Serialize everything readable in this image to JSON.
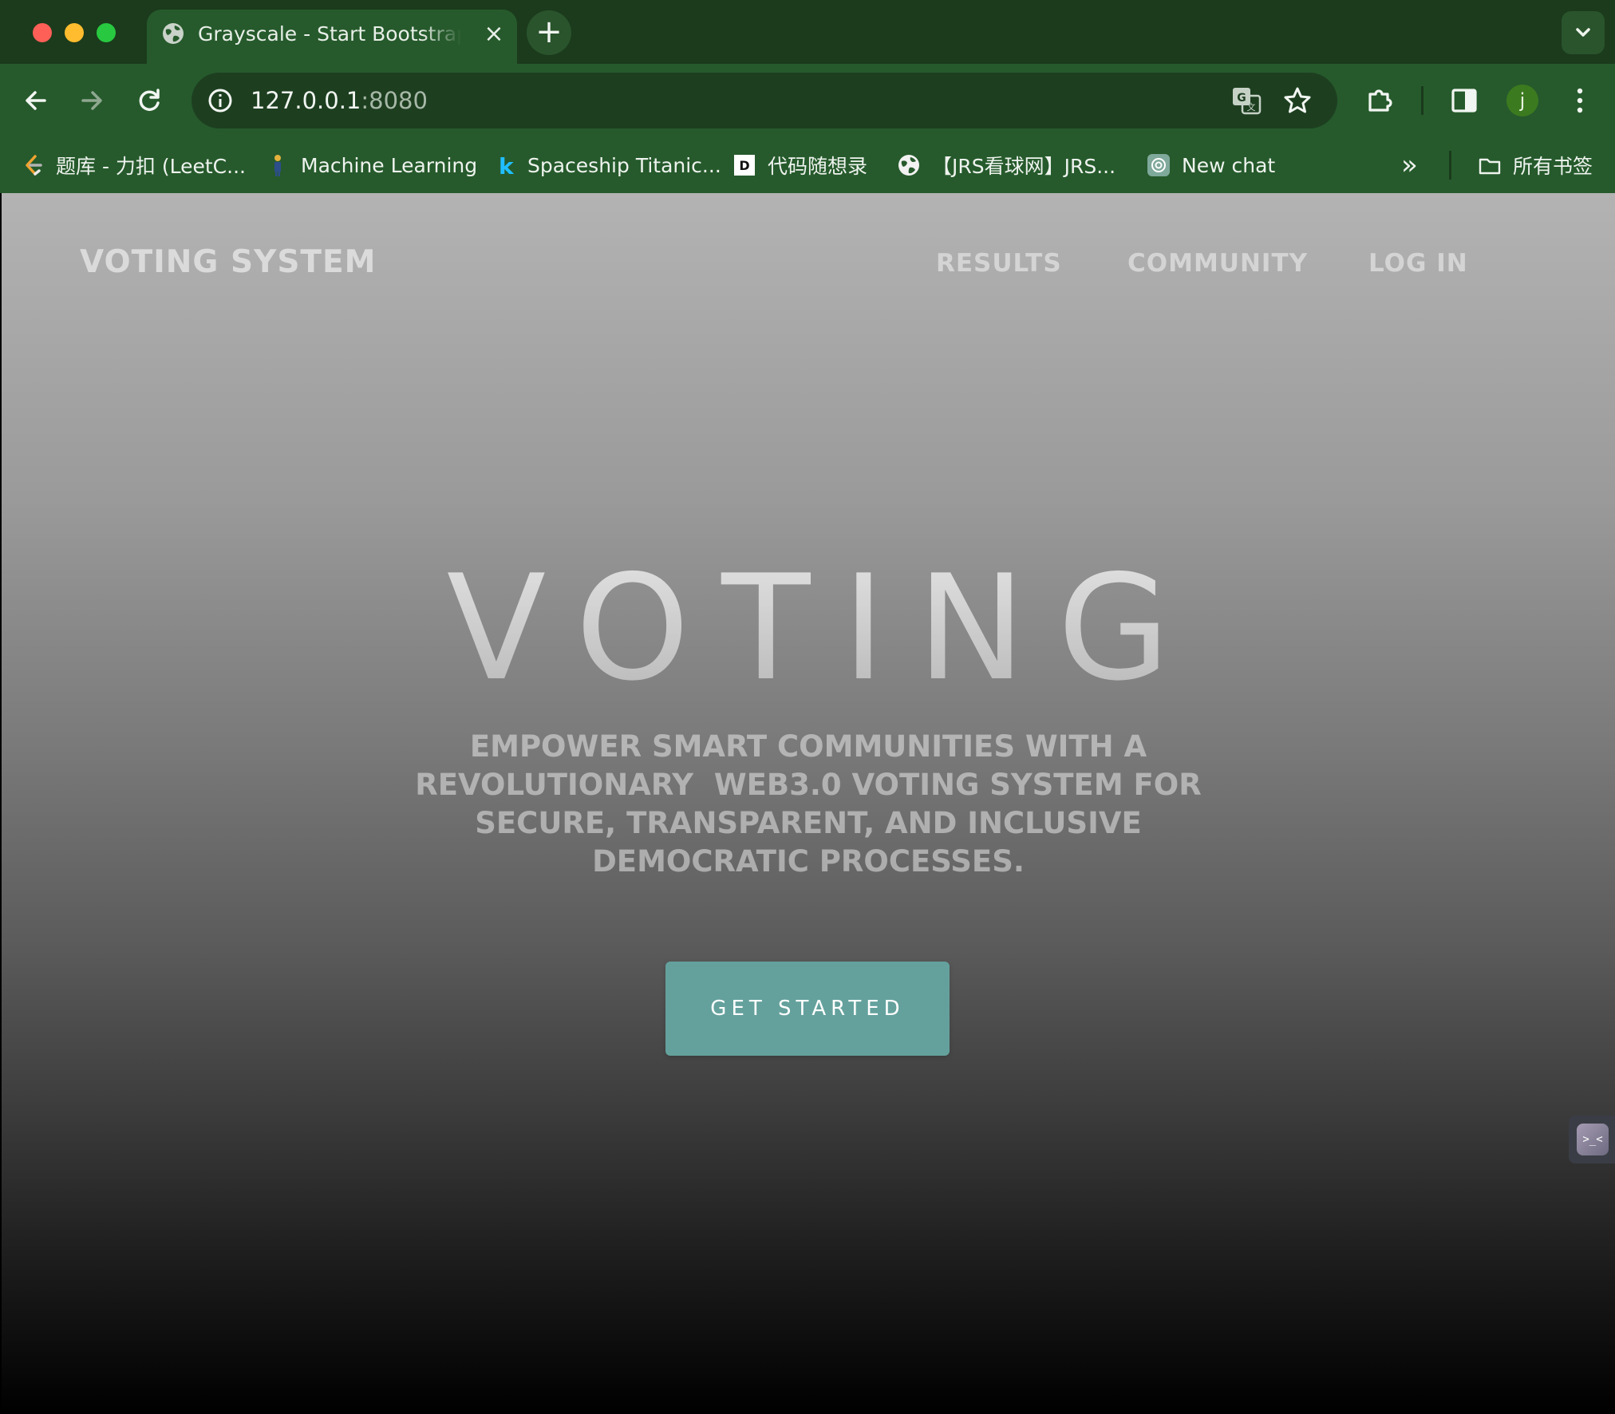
{
  "browser": {
    "tab": {
      "title": "Grayscale - Start Bootstrap Theme",
      "close_glyph": "×"
    },
    "new_tab_glyph": "+",
    "url_host": "127.0.0.1",
    "url_port": ":8080",
    "avatar_letter": "j",
    "bookmarks": [
      {
        "label": "题库 - 力扣 (LeetC...",
        "icon": "leetcode-icon"
      },
      {
        "label": "Machine Learning",
        "icon": "ml-icon"
      },
      {
        "label": "Spaceship Titanic...",
        "icon": "kaggle-icon"
      },
      {
        "label": "代码随想录",
        "icon": "daimasuixianglu-icon"
      },
      {
        "label": "【JRS看球网】JRS...",
        "icon": "globe-icon"
      },
      {
        "label": "New chat",
        "icon": "openai-icon"
      }
    ],
    "more_bookmarks_glyph": "»",
    "all_bookmarks_label": "所有书签"
  },
  "site": {
    "brand": "VOTING SYSTEM",
    "nav": [
      {
        "label": "RESULTS"
      },
      {
        "label": "COMMUNITY"
      },
      {
        "label": "LOG IN"
      }
    ],
    "hero_title": "VOTING",
    "hero_subtitle": "Empower smart communities with a revolutionary  Web3.0 voting system for secure, transparent, and inclusive democratic processes.",
    "cta_label": "GET STARTED",
    "widget_glyph": ">_<"
  },
  "colors": {
    "chrome_dark": "#1b3b1c",
    "chrome_toolbar": "#265a2c",
    "cta": "#64a19d"
  }
}
